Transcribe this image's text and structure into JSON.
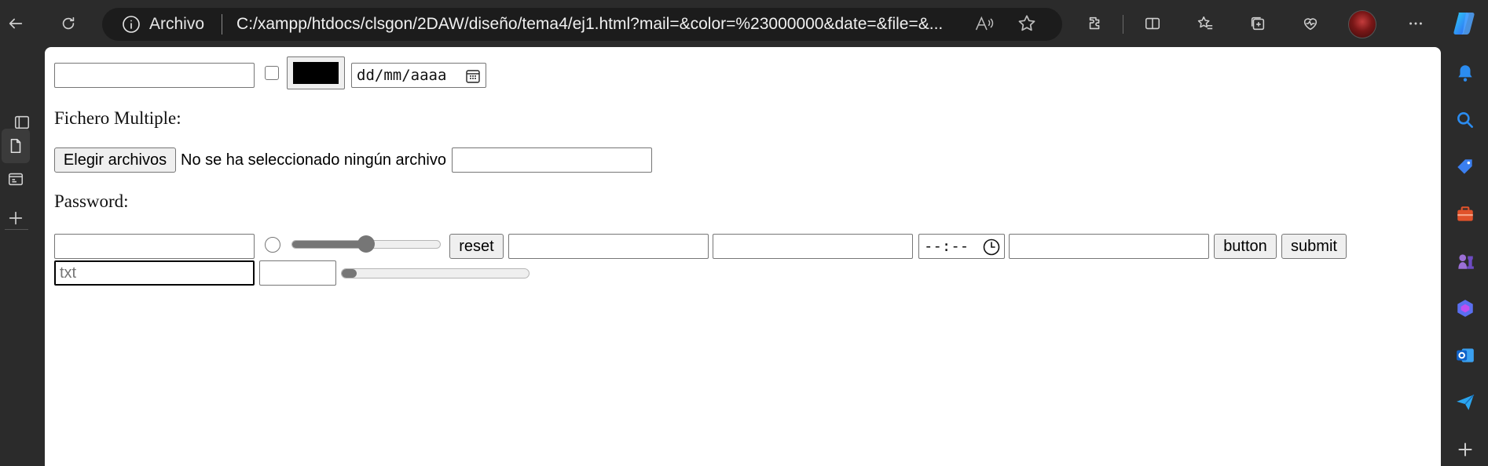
{
  "browser": {
    "site_label": "Archivo",
    "url": "C:/xampp/htdocs/clsgon/2DAW/diseño/tema4/ej1.html?mail=&color=%23000000&date=&file=&...",
    "read_aloud_label": "A⁾"
  },
  "form": {
    "mail_value": "",
    "checkbox_checked": false,
    "color_value": "#000000",
    "date_placeholder": "dd/mm/aaaa",
    "file_multiple_label": "Fichero Multiple:",
    "file_button_label": "Elegir archivos",
    "file_status": "No se ha seleccionado ningún archivo",
    "text_after_file_value": "",
    "password_label": "Password:",
    "password_value": "",
    "radio_checked": false,
    "range_value_fraction": 0.5,
    "reset_label": "reset",
    "input_a_value": "",
    "input_b_value": "",
    "time_placeholder": "--:--",
    "input_c_value": "",
    "button_label": "button",
    "submit_label": "submit",
    "txt_placeholder": "txt",
    "number_value": "",
    "progress_fraction": 0.08
  },
  "colors": {
    "accent_copilot": "#2f7bf5",
    "avatar": "#a52020"
  }
}
